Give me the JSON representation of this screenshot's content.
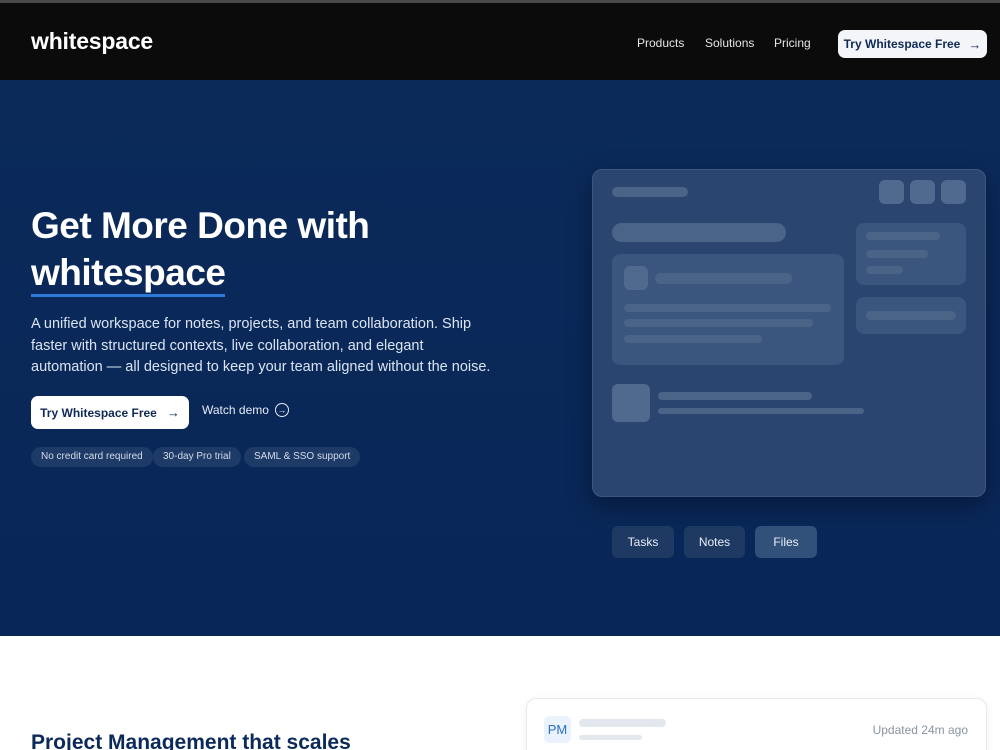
{
  "nav": {
    "logo": "whitespace",
    "links": [
      "Products",
      "Solutions",
      "Pricing"
    ],
    "cta_label": "Try Whitespace Free",
    "cta_icon": "arrow-right-icon"
  },
  "hero": {
    "title_line1": "Get More Done with",
    "title_brand": "whitespace",
    "description": "A unified workspace for notes, projects, and team collaboration. Ship faster with structured contexts, live collaboration, and elegant automation — all designed to keep your team aligned without the noise.",
    "primary_cta": "Try Whitespace Free",
    "secondary_cta": "Watch demo",
    "chips": [
      "No credit card required",
      "30-day Pro trial",
      "SAML & SSO support"
    ]
  },
  "mockup": {
    "tabs": [
      "Tasks",
      "Notes",
      "Files"
    ]
  },
  "section": {
    "title": "Project Management that scales",
    "card": {
      "badge": "PM",
      "updated": "Updated 24m ago"
    }
  },
  "colors": {
    "nav_bg": "#0b0b0b",
    "hero_bg": "#0b2a5a",
    "accent_underline": "#2f7ad8",
    "cta_text": "#0f2a55"
  }
}
